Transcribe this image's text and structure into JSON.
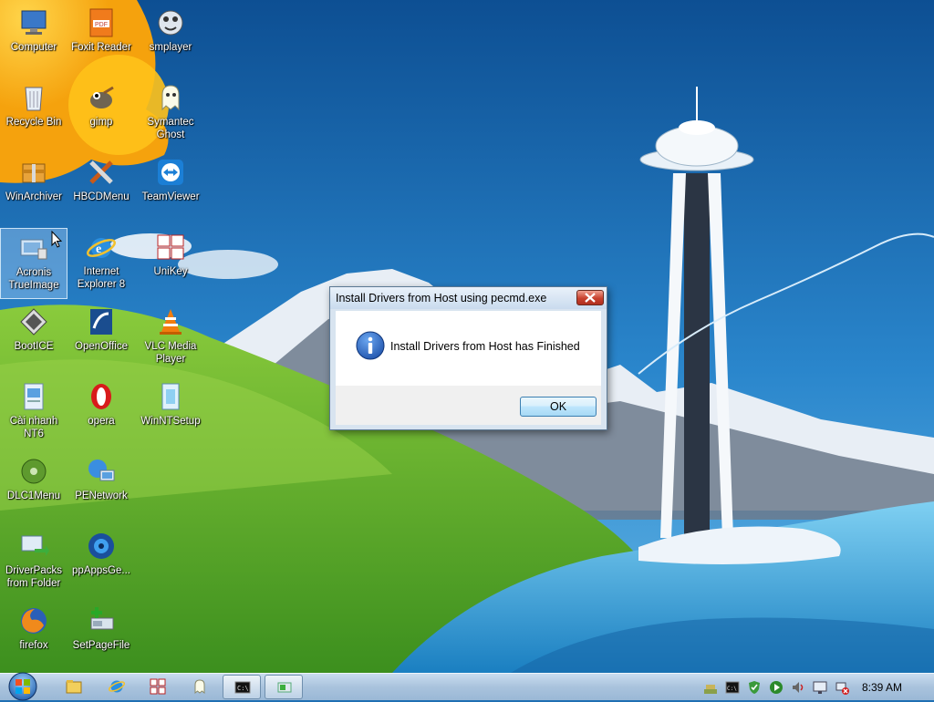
{
  "desktop": {
    "icons": [
      {
        "label": "Computer"
      },
      {
        "label": "Foxit Reader"
      },
      {
        "label": "smplayer"
      },
      {
        "label": "Recycle Bin"
      },
      {
        "label": "gimp"
      },
      {
        "label": "Symantec Ghost"
      },
      {
        "label": "WinArchiver"
      },
      {
        "label": "HBCDMenu"
      },
      {
        "label": "TeamViewer"
      },
      {
        "label": "Acronis TrueImage"
      },
      {
        "label": "Internet Explorer 8"
      },
      {
        "label": "UniKey"
      },
      {
        "label": "BootICE"
      },
      {
        "label": "OpenOffice"
      },
      {
        "label": "VLC Media Player"
      },
      {
        "label": "Cài nhanh NT6"
      },
      {
        "label": "opera"
      },
      {
        "label": "WinNTSetup"
      },
      {
        "label": "DLC1Menu"
      },
      {
        "label": "PENetwork"
      },
      {
        "label": "DriverPacks from Folder"
      },
      {
        "label": "ppAppsGe..."
      },
      {
        "label": "firefox"
      },
      {
        "label": "SetPageFile"
      }
    ]
  },
  "dialog": {
    "title": "Install Drivers from Host using pecmd.exe",
    "message": "Install Drivers from Host has Finished",
    "ok_label": "OK",
    "icon": "info-icon"
  },
  "taskbar": {
    "start_icon": "windows-orb-icon",
    "buttons": [
      "explorer-icon",
      "internet-explorer-icon",
      "unikey-icon",
      "ghost-icon",
      "cmd-icon",
      "setpagefile-icon"
    ],
    "tray": [
      "network-icon",
      "cmd-tray-icon",
      "shield-check-icon",
      "play-icon",
      "volume-icon",
      "monitor-icon",
      "network-error-icon"
    ],
    "clock": "8:39 AM"
  },
  "colors": {
    "sky": "#1f6fb3",
    "grass": "#5aa82c",
    "sun": "#ffc21a",
    "taskbar": "#b7cfe6",
    "dialog_close": "#c8412e"
  }
}
